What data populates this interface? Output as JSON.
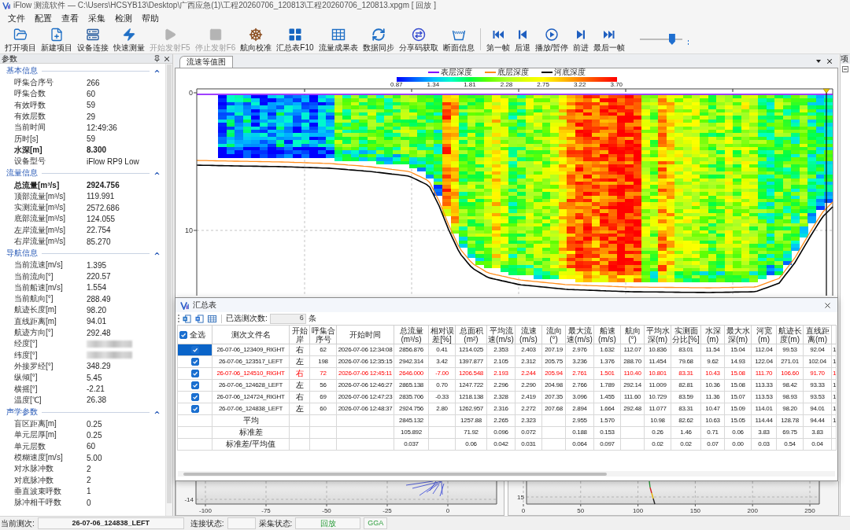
{
  "window": {
    "title": "iFlow 测流软件 — C:\\Users\\HCSYB13\\Desktop\\广西应急(1)\\工程20260706_120813\\工程20260706_120813.xpgm [ 回放 ]"
  },
  "menu": [
    "文件",
    "配置",
    "查看",
    "采集",
    "检测",
    "帮助"
  ],
  "toolbar": {
    "project": [
      {
        "label": "打开项目",
        "disabled": false
      },
      {
        "label": "新建项目",
        "disabled": false
      },
      {
        "label": "设备连接",
        "disabled": false
      },
      {
        "label": "快速测量",
        "disabled": false
      },
      {
        "label": "开始发射F5",
        "disabled": true
      },
      {
        "label": "停止发射F6",
        "disabled": true
      },
      {
        "label": "航向校准",
        "disabled": false
      },
      {
        "label": "汇总表F10",
        "disabled": false
      },
      {
        "label": "流量成果表",
        "disabled": false
      },
      {
        "label": "数据同步",
        "disabled": false
      },
      {
        "label": "分享码获取",
        "disabled": false
      },
      {
        "label": "断面信息",
        "disabled": false
      }
    ],
    "playback": [
      {
        "label": "第一帧",
        "disabled": false
      },
      {
        "label": "后退",
        "disabled": false
      },
      {
        "label": "播放/暂停",
        "disabled": false
      },
      {
        "label": "前进",
        "disabled": false
      },
      {
        "label": "最后一帧",
        "disabled": false
      }
    ],
    "slider": {
      "level": 0.75
    }
  },
  "params_panel": {
    "title": "参数",
    "groups": [
      {
        "title": "基本信息",
        "expanded": true,
        "rows": [
          {
            "label": "呼集合序号",
            "value": "266",
            "kind": "plain"
          },
          {
            "label": "呼集合数",
            "value": "60",
            "kind": "plain"
          },
          {
            "label": "有效呼数",
            "value": "59",
            "kind": "plain"
          },
          {
            "label": "有效层数",
            "value": "29",
            "kind": "plain"
          },
          {
            "label": "当前时间",
            "value": "12:49:36",
            "kind": "plain"
          },
          {
            "label": "历时[s]",
            "value": "59",
            "kind": "plain"
          },
          {
            "label": "水深[m]",
            "value": "8.300",
            "kind": "bold"
          },
          {
            "label": "设备型号",
            "value": "iFlow RP9 Low",
            "kind": "plain"
          }
        ]
      },
      {
        "title": "流量信息",
        "expanded": true,
        "rows": [
          {
            "label": "总流量[m³/s]",
            "value": "2924.756",
            "kind": "bold"
          },
          {
            "label": "顶部流量[m³/s]",
            "value": "119.991",
            "kind": "plain"
          },
          {
            "label": "实测流量[m³/s]",
            "value": "2572.686",
            "kind": "plain"
          },
          {
            "label": "底部流量[m³/s]",
            "value": "124.055",
            "kind": "plain"
          },
          {
            "label": "左岸流量[m³/s]",
            "value": "22.754",
            "kind": "plain"
          },
          {
            "label": "右岸流量[m³/s]",
            "value": "85.270",
            "kind": "plain"
          }
        ]
      },
      {
        "title": "导航信息",
        "expanded": true,
        "rows": [
          {
            "label": "当前流速[m/s]",
            "value": "1.395",
            "kind": "plain"
          },
          {
            "label": "当前流向[°]",
            "value": "220.57",
            "kind": "plain"
          },
          {
            "label": "当前船速[m/s]",
            "value": "1.554",
            "kind": "plain"
          },
          {
            "label": "当前航向[°]",
            "value": "288.49",
            "kind": "plain"
          },
          {
            "label": "航迹长度[m]",
            "value": "98.20",
            "kind": "plain"
          },
          {
            "label": "直线距离[m]",
            "value": "94.01",
            "kind": "plain"
          },
          {
            "label": "航迹方向[°]",
            "value": "292.48",
            "kind": "plain"
          },
          {
            "label": "经度[°]",
            "kind": "redacted"
          },
          {
            "label": "纬度[°]",
            "kind": "redacted"
          },
          {
            "label": "外接罗经[°]",
            "value": "348.29",
            "kind": "plain"
          },
          {
            "label": "纵倾[°]",
            "value": "5.45",
            "kind": "plain"
          },
          {
            "label": "横摇[°]",
            "value": "-2.21",
            "kind": "plain"
          },
          {
            "label": "温度[℃]",
            "value": "26.38",
            "kind": "plain"
          }
        ]
      },
      {
        "title": "声学参数",
        "expanded": true,
        "rows": [
          {
            "label": "盲区距离[m]",
            "value": "0.25",
            "kind": "plain"
          },
          {
            "label": "单元层厚[m]",
            "value": "0.25",
            "kind": "plain"
          },
          {
            "label": "单元层数",
            "value": "60",
            "kind": "plain"
          },
          {
            "label": "模糊速度[m/s]",
            "value": "5.00",
            "kind": "plain"
          },
          {
            "label": "对水脉冲数",
            "value": "2",
            "kind": "plain"
          },
          {
            "label": "对底脉冲数",
            "value": "2",
            "kind": "plain"
          },
          {
            "label": "垂直波束呼数",
            "value": "1",
            "kind": "plain"
          },
          {
            "label": "脉冲相干呼数",
            "value": "0",
            "kind": "plain"
          }
        ]
      }
    ]
  },
  "chart_tab": {
    "label": "流速等值图",
    "selected": true
  },
  "contour_chart": {
    "legend": [
      {
        "label": "表层深度",
        "color": "#8000ff"
      },
      {
        "label": "底层深度",
        "color": "#ff8c1a"
      },
      {
        "label": "河底深度",
        "color": "#000000"
      }
    ],
    "color_scale": [
      "0.87",
      "1.34",
      "1.81",
      "2.28",
      "2.75",
      "3.22",
      "3.70"
    ],
    "y_ticks": [
      "0",
      "10"
    ]
  },
  "bottom_charts": [
    {
      "kind": "vectors",
      "y_ticks": [
        "-14"
      ],
      "x_ticks": [
        "-100",
        "-75",
        "-50",
        "-25",
        "0"
      ]
    },
    {
      "kind": "track",
      "y_ticks": [
        "15"
      ],
      "x_ticks": [
        "0",
        "50",
        "100",
        "150",
        "200",
        "250"
      ]
    }
  ],
  "summary_dialog": {
    "title": "汇总表",
    "selected_count_label": "已选测次数:",
    "selected_count": "6",
    "count_unit": "条",
    "select_all": {
      "label": "全选",
      "checked": true
    },
    "columns": [
      "测次文件名",
      "开始岸",
      "呼集合序号",
      "开始时间",
      "总流量(m³/s)",
      "相对误差[%]",
      "总面积(m²)",
      "平均流速(m/s)",
      "流速(m/s)",
      "流向(°)",
      "最大流速(m/s)",
      "船速(m/s)",
      "航向(°)",
      "平均水深(m)",
      "实测面分比[%]",
      "水深(m)",
      "最大水深(m)",
      "河宽(m)",
      "航迹长度(m)",
      "直线距离(m)"
    ],
    "runs": [
      {
        "checked": true,
        "selected": true,
        "abnormal": false,
        "cells": [
          "26-07-06_123409_RIGHT",
          "右",
          "62",
          "2026-07-06 12:34:08",
          "2856.876",
          "0.41",
          "1214.025",
          "2.353",
          "2.403",
          "207.19",
          "2.976",
          "1.632",
          "112.07",
          "10.836",
          "83.01",
          "11.54",
          "15.04",
          "112.04",
          "99.53",
          "92.04",
          "1"
        ]
      },
      {
        "checked": true,
        "selected": false,
        "abnormal": false,
        "cells": [
          "26-07-06_123517_LEFT",
          "左",
          "198",
          "2026-07-06 12:35:15",
          "2942.314",
          "3.42",
          "1397.877",
          "2.105",
          "2.312",
          "205.75",
          "3.236",
          "1.376",
          "288.70",
          "11.454",
          "79.68",
          "9.62",
          "14.93",
          "122.04",
          "271.01",
          "102.04",
          "1"
        ]
      },
      {
        "checked": true,
        "selected": false,
        "abnormal": true,
        "cells": [
          "26-07-06_124510_RIGHT",
          "右",
          "72",
          "2026-07-06 12:45:11",
          "2646.000",
          "-7.00",
          "1206.548",
          "2.193",
          "2.244",
          "205.94",
          "2.761",
          "1.501",
          "110.40",
          "10.801",
          "83.31",
          "10.43",
          "15.08",
          "111.70",
          "106.60",
          "91.70",
          "1"
        ]
      },
      {
        "checked": true,
        "selected": false,
        "abnormal": false,
        "cells": [
          "26-07-06_124628_LEFT",
          "左",
          "56",
          "2026-07-06 12:46:27",
          "2865.138",
          "0.70",
          "1247.722",
          "2.296",
          "2.290",
          "204.98",
          "2.766",
          "1.789",
          "292.14",
          "11.009",
          "82.81",
          "10.36",
          "15.08",
          "113.33",
          "98.42",
          "93.33",
          "1"
        ]
      },
      {
        "checked": true,
        "selected": false,
        "abnormal": false,
        "cells": [
          "26-07-06_124724_RIGHT",
          "右",
          "69",
          "2026-07-06 12:47:23",
          "2835.706",
          "-0.33",
          "1218.138",
          "2.328",
          "2.419",
          "207.35",
          "3.096",
          "1.455",
          "111.60",
          "10.729",
          "83.59",
          "11.36",
          "15.07",
          "113.53",
          "98.93",
          "93.53",
          "1"
        ]
      },
      {
        "checked": true,
        "selected": false,
        "abnormal": false,
        "cells": [
          "26-07-06_124838_LEFT",
          "左",
          "60",
          "2026-07-06 12:48:37",
          "2924.756",
          "2.80",
          "1262.957",
          "2.316",
          "2.272",
          "207.68",
          "2.894",
          "1.664",
          "292.48",
          "11.077",
          "83.31",
          "10.47",
          "15.09",
          "114.01",
          "98.20",
          "94.01",
          "1"
        ]
      }
    ],
    "stats": [
      {
        "cells": [
          "平均",
          null,
          null,
          null,
          "2845.132",
          null,
          "1257.88",
          "2.265",
          "2.323",
          null,
          "2.955",
          "1.570",
          null,
          "10.98",
          "82.62",
          "10.63",
          "15.05",
          "114.44",
          "128.78",
          "94.44",
          "1"
        ]
      },
      {
        "cells": [
          "标准差",
          null,
          null,
          null,
          "105.892",
          null,
          "71.92",
          "0.096",
          "0.072",
          null,
          "0.188",
          "0.153",
          null,
          "0.26",
          "1.46",
          "0.71",
          "0.06",
          "3.83",
          "69.75",
          "3.83"
        ]
      },
      {
        "cells": [
          "标准差/平均值",
          null,
          null,
          null,
          "0.037",
          null,
          "0.06",
          "0.042",
          "0.031",
          null,
          "0.064",
          "0.097",
          null,
          "0.02",
          "0.02",
          "0.07",
          "0.00",
          "0.03",
          "0.54",
          "0.04"
        ]
      }
    ]
  },
  "project_panel": {
    "title": "项"
  },
  "status_bar": {
    "current_run_label": "当前测次:",
    "current_run": "26-07-06_124838_LEFT",
    "connection_label": "连接状态:",
    "acquisition_label": "采集状态:",
    "acquisition": "回放",
    "gps": "GGA"
  }
}
